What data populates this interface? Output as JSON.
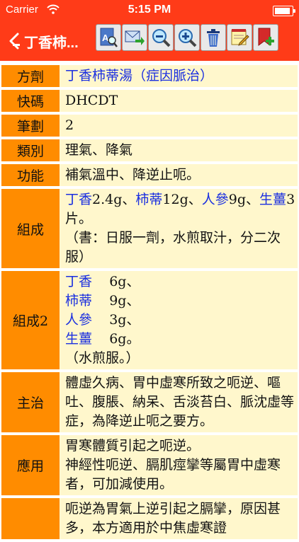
{
  "status": {
    "carrier": "Carrier",
    "time": "5:15 PM"
  },
  "nav": {
    "back_label": "丁香柿...",
    "tools": [
      "search-doc-icon",
      "mail-forward-icon",
      "zoom-out-icon",
      "zoom-in-icon",
      "trash-icon",
      "notepad-icon",
      "add-bookmark-icon"
    ]
  },
  "rows": {
    "fangji": {
      "label": "方劑",
      "value": "丁香柿蒂湯（症因脈治）"
    },
    "kuaima": {
      "label": "快碼",
      "value": "DHCDT"
    },
    "bihua": {
      "label": "筆劃",
      "value": "2"
    },
    "leibie": {
      "label": "類別",
      "value": "理氣、降氣"
    },
    "gongneng": {
      "label": "功能",
      "value": "補氣溫中、降逆止呃。"
    },
    "zucheng": {
      "label": "組成",
      "items": [
        {
          "herb": "丁香",
          "dose": "2.4g、"
        },
        {
          "herb": "柿蒂",
          "dose": "12g、"
        },
        {
          "herb": "人參",
          "dose": "9g、"
        },
        {
          "herb": "生薑",
          "dose": "3片。"
        }
      ],
      "note": "（書：日服一劑，水煎取汁，分二次服）"
    },
    "zucheng2": {
      "label": "組成2",
      "items": [
        {
          "herb": "丁香",
          "dose": "6g、"
        },
        {
          "herb": "柿蒂",
          "dose": "9g、"
        },
        {
          "herb": "人參",
          "dose": "3g、"
        },
        {
          "herb": "生薑",
          "dose": "6g。"
        }
      ],
      "note": "（水煎服。）"
    },
    "zhuzhi": {
      "label": "主治",
      "value": "體虛久病、胃中虛寒所致之呃逆、嘔吐、腹脹、納呆、舌淡苔白、脈沈虛等症，為降逆止呃之要方。"
    },
    "yingyong": {
      "label": "應用",
      "lines": [
        "胃寒體質引起之呃逆。",
        "神經性呃逆、膈肌痙攣等屬胃中虛寒者，可加減使用。"
      ]
    },
    "last": {
      "label": "",
      "value": "呃逆為胃氣上逆引起之膈攣，原因甚多，本方適用於中焦虛寒證"
    }
  }
}
